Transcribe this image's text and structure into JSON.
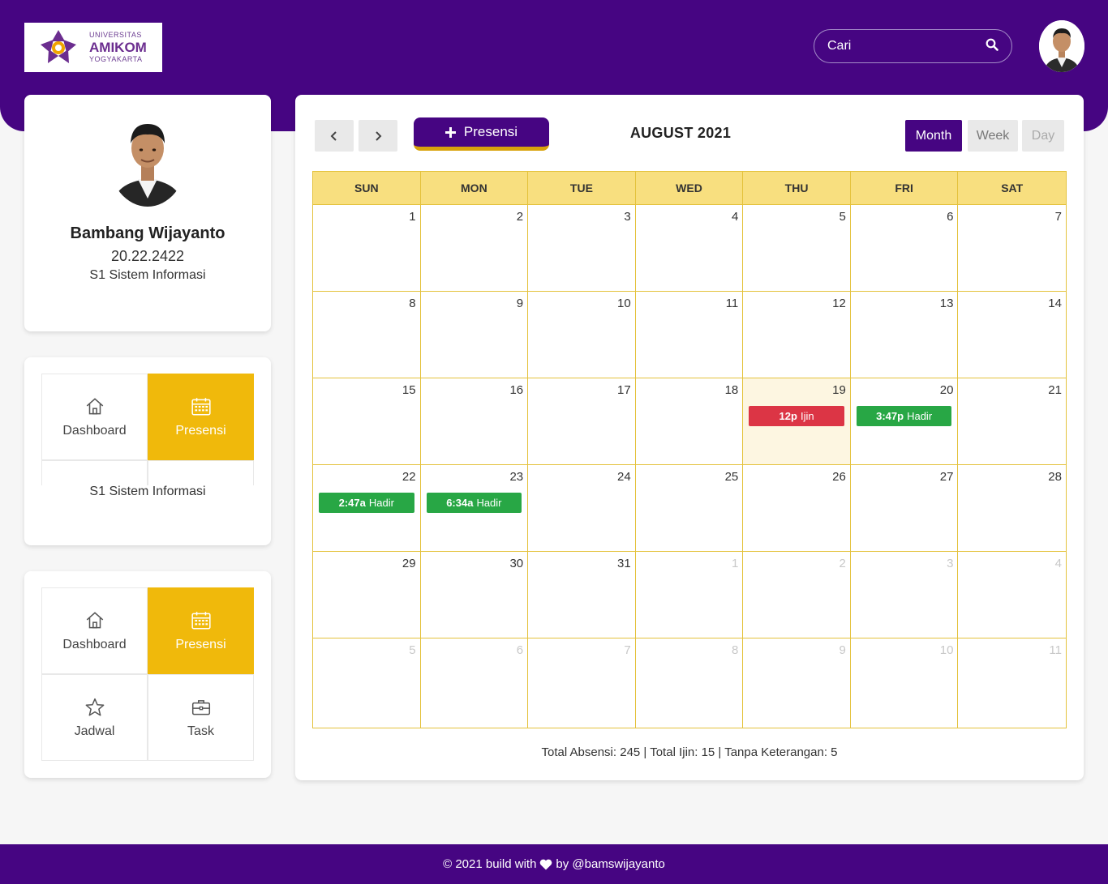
{
  "header": {
    "logo": {
      "line1": "UNIVERSITAS",
      "line2": "AMIKOM",
      "line3": "YOGYAKARTA"
    },
    "search": {
      "placeholder": "Cari"
    },
    "colors": {
      "primary": "#460582",
      "accent": "#f0b90b"
    }
  },
  "profile": {
    "name": "Bambang Wijayanto",
    "nim": "20.22.2422",
    "prodi": "S1 Sistem Informasi"
  },
  "menu_card_1": {
    "items": [
      {
        "label": "Dashboard",
        "icon": "home-icon",
        "active": false
      },
      {
        "label": "Presensi",
        "icon": "calendar-icon",
        "active": true
      }
    ],
    "overlay_text": "S1 Sistem Informasi"
  },
  "menu_card_2": {
    "items": [
      {
        "label": "Dashboard",
        "icon": "home-icon",
        "active": false
      },
      {
        "label": "Presensi",
        "icon": "calendar-icon",
        "active": true
      },
      {
        "label": "Jadwal",
        "icon": "star-icon",
        "active": false
      },
      {
        "label": "Task",
        "icon": "briefcase-icon",
        "active": false
      }
    ]
  },
  "calendar": {
    "prev_icon": "chevron-left-icon",
    "next_icon": "chevron-right-icon",
    "add_button": "Presensi",
    "title": "AUGUST 2021",
    "views": {
      "month": "Month",
      "week": "Week",
      "day": "Day",
      "active": "Month"
    },
    "weekdays": [
      "SUN",
      "MON",
      "TUE",
      "WED",
      "THU",
      "FRI",
      "SAT"
    ],
    "weeks": [
      [
        {
          "d": "1"
        },
        {
          "d": "2"
        },
        {
          "d": "3"
        },
        {
          "d": "4"
        },
        {
          "d": "5"
        },
        {
          "d": "6"
        },
        {
          "d": "7"
        }
      ],
      [
        {
          "d": "8"
        },
        {
          "d": "9"
        },
        {
          "d": "10"
        },
        {
          "d": "11"
        },
        {
          "d": "12"
        },
        {
          "d": "13"
        },
        {
          "d": "14"
        }
      ],
      [
        {
          "d": "15"
        },
        {
          "d": "16"
        },
        {
          "d": "17"
        },
        {
          "d": "18"
        },
        {
          "d": "19",
          "today": true,
          "event": {
            "time": "12p",
            "label": "Ijin",
            "color": "#dc3545"
          }
        },
        {
          "d": "20",
          "event": {
            "time": "3:47p",
            "label": "Hadir",
            "color": "#28a745"
          }
        },
        {
          "d": "21"
        }
      ],
      [
        {
          "d": "22",
          "event": {
            "time": "2:47a",
            "label": "Hadir",
            "color": "#28a745"
          }
        },
        {
          "d": "23",
          "event": {
            "time": "6:34a",
            "label": "Hadir",
            "color": "#28a745"
          }
        },
        {
          "d": "24"
        },
        {
          "d": "25"
        },
        {
          "d": "26"
        },
        {
          "d": "27"
        },
        {
          "d": "28"
        }
      ],
      [
        {
          "d": "29"
        },
        {
          "d": "30"
        },
        {
          "d": "31"
        },
        {
          "d": "1",
          "other": true
        },
        {
          "d": "2",
          "other": true
        },
        {
          "d": "3",
          "other": true
        },
        {
          "d": "4",
          "other": true
        }
      ],
      [
        {
          "d": "5",
          "other": true
        },
        {
          "d": "6",
          "other": true
        },
        {
          "d": "7",
          "other": true
        },
        {
          "d": "8",
          "other": true
        },
        {
          "d": "9",
          "other": true
        },
        {
          "d": "10",
          "other": true
        },
        {
          "d": "11",
          "other": true
        }
      ]
    ],
    "summary": "Total Absensi: 245 | Total Ijin: 15 | Tanpa Keterangan: 5"
  },
  "footer": {
    "prefix": "© 2021 build with",
    "icon": "heart-icon",
    "suffix": "by @bamswijayanto"
  }
}
